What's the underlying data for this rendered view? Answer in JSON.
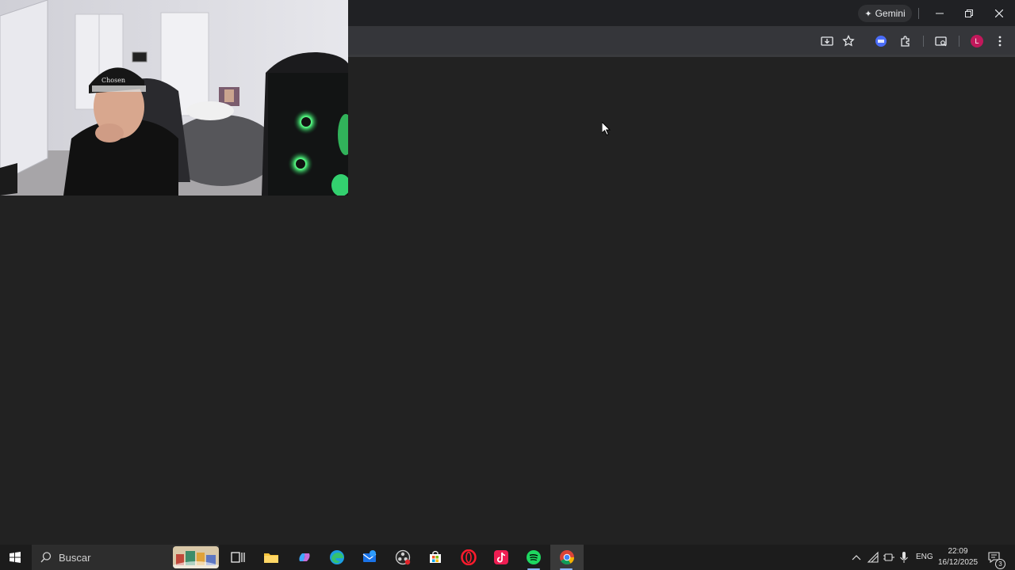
{
  "browser": {
    "gemini_label": "Gemini",
    "profile_initial": "L"
  },
  "webcam": {
    "cap_text": "Chosen",
    "visible": true
  },
  "taskbar": {
    "search_placeholder": "Buscar",
    "language": "ENG",
    "time": "22:09",
    "date": "16/12/2025",
    "notification_count": "3",
    "apps": [
      "task-view",
      "file-explorer",
      "copilot",
      "edge",
      "mail",
      "obs",
      "store",
      "opera",
      "tiktok",
      "spotify",
      "chrome"
    ]
  },
  "colors": {
    "background": "#222222",
    "chrome_top": "#202124",
    "toolbar": "#35363a",
    "taskbar": "#1c1c1c",
    "profile": "#c2185b"
  }
}
